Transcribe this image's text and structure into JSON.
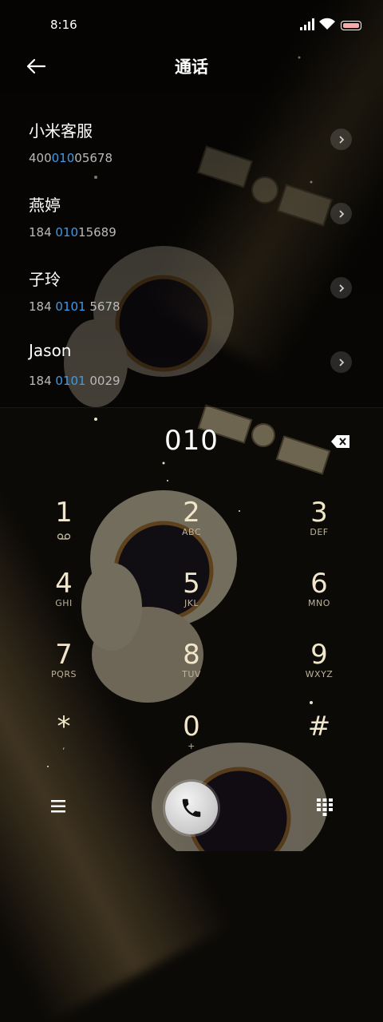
{
  "status_bar": {
    "time": "8:16"
  },
  "header": {
    "title": "通话"
  },
  "contacts": [
    {
      "name": "小米客服",
      "num_pre": "400",
      "num_match": "010",
      "num_post": "05678"
    },
    {
      "name": "燕婷",
      "num_pre": "184 ",
      "num_match": "010",
      "num_post": "15689"
    },
    {
      "name": "子玲",
      "num_pre": "184 ",
      "num_match": "0101",
      "num_post": " 5678"
    },
    {
      "name": "Jason",
      "num_pre": "184 ",
      "num_match": "0101",
      "num_post": " 0029"
    }
  ],
  "dialer": {
    "input": "010",
    "keys": [
      {
        "digit": "1",
        "letters": ""
      },
      {
        "digit": "2",
        "letters": "ABC"
      },
      {
        "digit": "3",
        "letters": "DEF"
      },
      {
        "digit": "4",
        "letters": "GHI"
      },
      {
        "digit": "5",
        "letters": "JKL"
      },
      {
        "digit": "6",
        "letters": "MNO"
      },
      {
        "digit": "7",
        "letters": "PQRS"
      },
      {
        "digit": "8",
        "letters": "TUV"
      },
      {
        "digit": "9",
        "letters": "WXYZ"
      },
      {
        "digit": "*",
        "letters": ","
      },
      {
        "digit": "0",
        "letters": "+"
      },
      {
        "digit": "#",
        "letters": ""
      }
    ]
  },
  "colors": {
    "highlight": "#3f9ae6",
    "key_digit": "#f1e6c9",
    "background": "#0c0a07"
  },
  "icons": [
    "back-arrow-icon",
    "chevron-right-icon",
    "voicemail-icon",
    "backspace-icon",
    "menu-icon",
    "phone-icon",
    "keypad-icon"
  ]
}
